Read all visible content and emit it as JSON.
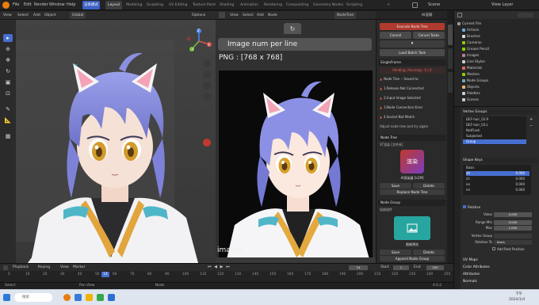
{
  "menubar": {
    "menus": [
      "File",
      "Edit",
      "Render",
      "Window",
      "Help"
    ],
    "workspace_tabs": [
      "渲染模式",
      "Layout",
      "Modeling",
      "Sculpting",
      "UV Editing",
      "Texture Paint",
      "Shading",
      "Animation",
      "Rendering",
      "Compositing",
      "Geometry Nodes",
      "Scripting"
    ],
    "active_workspace": "Layout",
    "highlight_tab": "渲染模式",
    "scene": "Scene",
    "view_layer": "View Layer"
  },
  "viewport": {
    "header_items": [
      "View",
      "Select",
      "Add",
      "Object"
    ],
    "mode": "Global",
    "options_label": "Options",
    "axis_labels": [
      "Z",
      "X",
      "Y"
    ]
  },
  "image_editor": {
    "header_items": [
      "View",
      "Select",
      "Add",
      "Node"
    ],
    "node_tree_label": "NodeTree",
    "field_label": "Image num per line",
    "png_label": "PNG : [768 x 768]",
    "images_label": "images"
  },
  "npanel": {
    "header": "AI渲染",
    "execute_button": "Execute Node Tree",
    "cancel_button": "Cancel",
    "cancel_all_button": "Cancel Tasks",
    "pause_icon": "pause-icon",
    "load_batch_button": "Load Batch Task",
    "single_frame_section": "SingleFrame",
    "pending_label": "Pending | Running : 0 | 0",
    "warnings": [
      "Node Tree -- Saved to:",
      "1.Release Not Connected",
      "2.Input Image Selected",
      "3.Node Connection Error",
      "4.Socket Not Match",
      "Adjust node tree and try again"
    ],
    "node_tree_section": "Node Tree",
    "tree_name": "ST渲染 [文件夹]",
    "render_card_title": "渲染",
    "render_card_caption": "AI渲染器 [LCM]",
    "save_btn": "Save",
    "delete_btn": "Delete",
    "replace_btn": "Replace Node Tree",
    "node_group_section": "Node Group",
    "group_name": "局部组件",
    "group_caption": "图像预览",
    "save_group_btn": "Save",
    "delete_group_btn": "Delete",
    "append_group_btn": "Append Node Group"
  },
  "outliner": {
    "items": [
      {
        "label": "Current File",
        "indent": 0,
        "color": "#9a9a9a"
      },
      {
        "label": "Actions",
        "indent": 1,
        "color": "#6fa8dc"
      },
      {
        "label": "Brushes",
        "indent": 1,
        "color": "#d9d9d9"
      },
      {
        "label": "Cameras",
        "indent": 1,
        "color": "#8fce00"
      },
      {
        "label": "Grease Pencil",
        "indent": 1,
        "color": "#8fce00"
      },
      {
        "label": "Images",
        "indent": 1,
        "color": "#c27ba0"
      },
      {
        "label": "Line Styles",
        "indent": 1,
        "color": "#cccccc"
      },
      {
        "label": "Materials",
        "indent": 1,
        "color": "#e06666"
      },
      {
        "label": "Meshes",
        "indent": 1,
        "color": "#8fce00"
      },
      {
        "label": "Node Groups",
        "indent": 1,
        "color": "#76a5af"
      },
      {
        "label": "Objects",
        "indent": 1,
        "color": "#f6b26b"
      },
      {
        "label": "Palettes",
        "indent": 1,
        "color": "#cccccc"
      },
      {
        "label": "Scenes",
        "indent": 1,
        "color": "#cccccc"
      }
    ]
  },
  "properties": {
    "vertex_groups": "Vertex Groups",
    "vg_items": [
      "DEF-hair_03.R",
      "DEF-hair_03.L",
      "NotFlash",
      "Subjected",
      "Group"
    ],
    "shape_keys": "Shape Keys",
    "sk_items": [
      {
        "name": "Basis",
        "value": ""
      },
      {
        "name": "ah",
        "value": "0.000"
      },
      {
        "name": "ch",
        "value": "0.000"
      },
      {
        "name": "oo",
        "value": "0.000"
      },
      {
        "name": "mi",
        "value": "0.000"
      }
    ],
    "relative": "Relative",
    "value_label": "Value",
    "value": "0.000",
    "range_min_label": "Range Min",
    "range_min": "0.000",
    "max_label": "Max",
    "max": "1.000",
    "vgroup_label": "Vertex Group",
    "relative_to_label": "Relative To",
    "relative_to": "Basis",
    "add_rest": "Add Rest Position",
    "uv_maps": "UV Maps",
    "color_attributes": "Color Attributes",
    "attributes": "Attributes",
    "normals": "Normals"
  },
  "timeline": {
    "header_items": [
      "Playback",
      "Keying",
      "View",
      "Marker"
    ],
    "current_frame": "14",
    "start_label": "Start",
    "start": "1",
    "end_label": "End",
    "end": "250",
    "ticks": [
      "0",
      "10",
      "20",
      "30",
      "40",
      "50",
      "60",
      "70",
      "80",
      "90",
      "100",
      "110",
      "120",
      "130",
      "140",
      "150",
      "160",
      "170",
      "180",
      "190",
      "200",
      "210",
      "220",
      "230",
      "240",
      "250"
    ]
  },
  "statusbar": {
    "left": "Select",
    "mid": "Pan View",
    "right": "Node",
    "version": "4.0.2"
  },
  "taskbar": {
    "search_placeholder": "搜索",
    "clock": "下午",
    "date": "2024/1/4"
  },
  "colors": {
    "accent": "#e87d0d",
    "select_blue": "#476fd0",
    "execute_red": "#c0392b",
    "warning_red": "#e0574a",
    "hair": "#8b8fe0"
  }
}
